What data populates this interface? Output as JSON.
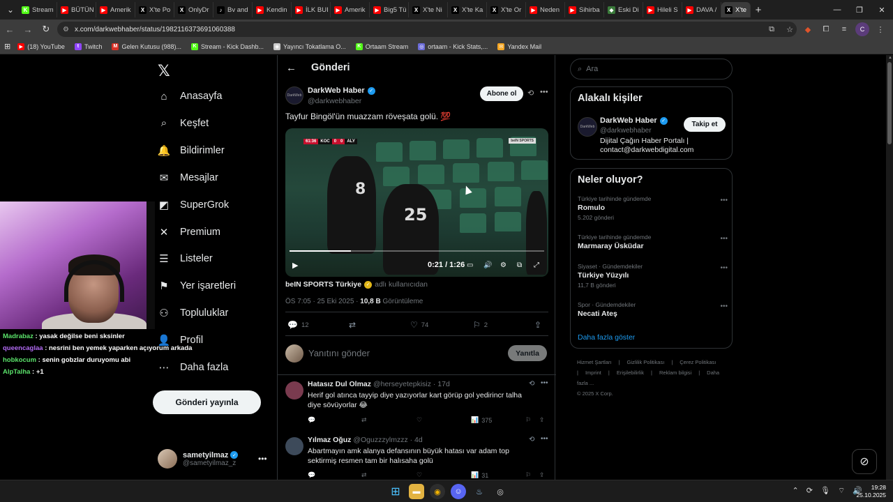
{
  "browser": {
    "tabs": [
      {
        "label": "Stream",
        "color": "#53fc18",
        "glyph": "K"
      },
      {
        "label": "BÜTÜN",
        "color": "#ff0000",
        "glyph": "▶"
      },
      {
        "label": "Amerik",
        "color": "#ff0000",
        "glyph": "▶"
      },
      {
        "label": "X'te Po",
        "color": "#000000",
        "glyph": "X"
      },
      {
        "label": "OnlyDr",
        "color": "#000000",
        "glyph": "X"
      },
      {
        "label": "Bv and",
        "color": "#000000",
        "glyph": "♪"
      },
      {
        "label": "Kendin",
        "color": "#ff0000",
        "glyph": "▶"
      },
      {
        "label": "İLK BUI",
        "color": "#ff0000",
        "glyph": "▶"
      },
      {
        "label": "Amerik",
        "color": "#ff0000",
        "glyph": "▶"
      },
      {
        "label": "Big5 Tü",
        "color": "#ff0000",
        "glyph": "▶"
      },
      {
        "label": "X'te Ni",
        "color": "#000000",
        "glyph": "X"
      },
      {
        "label": "X'te Ka",
        "color": "#000000",
        "glyph": "X"
      },
      {
        "label": "X'te Or",
        "color": "#000000",
        "glyph": "X"
      },
      {
        "label": "Neden",
        "color": "#ff0000",
        "glyph": "▶"
      },
      {
        "label": "Sihirba",
        "color": "#ff0000",
        "glyph": "▶"
      },
      {
        "label": "Eski Di",
        "color": "#3a7a3a",
        "glyph": "◆"
      },
      {
        "label": "Hileli S",
        "color": "#ff0000",
        "glyph": "▶"
      },
      {
        "label": "DAVA /",
        "color": "#ff0000",
        "glyph": "▶"
      }
    ],
    "active_tab": {
      "label": "X'te",
      "glyph": "X"
    },
    "url": "x.com/darkwebhaber/status/1982116373691060388",
    "bookmarks": [
      {
        "label": "(18) YouTube",
        "color": "#ff0000",
        "glyph": "▶"
      },
      {
        "label": "Twitch",
        "color": "#9146ff",
        "glyph": "t"
      },
      {
        "label": "Gelen Kutusu (988)...",
        "color": "#d93025",
        "glyph": "M"
      },
      {
        "label": "Stream - Kick Dashb...",
        "color": "#53fc18",
        "glyph": "K"
      },
      {
        "label": "Yayıncı Tokatlama O...",
        "color": "#cccccc",
        "glyph": "◉"
      },
      {
        "label": "Ortaam Stream",
        "color": "#53fc18",
        "glyph": "K"
      },
      {
        "label": "ortaam - Kick Stats,...",
        "color": "#6b6bd8",
        "glyph": "◎"
      },
      {
        "label": "Yandex Mail",
        "color": "#f5a623",
        "glyph": "✉"
      }
    ],
    "profile_initial": "C"
  },
  "nav": {
    "items": [
      {
        "label": "Anasayfa",
        "icon": "⌂"
      },
      {
        "label": "Keşfet",
        "icon": "⌕"
      },
      {
        "label": "Bildirimler",
        "icon": "🔔"
      },
      {
        "label": "Mesajlar",
        "icon": "✉"
      },
      {
        "label": "SuperGrok",
        "icon": "◩"
      },
      {
        "label": "Premium",
        "icon": "✕"
      },
      {
        "label": "Listeler",
        "icon": "☰"
      },
      {
        "label": "Yer işaretleri",
        "icon": "⚑"
      },
      {
        "label": "Topluluklar",
        "icon": "⚇"
      },
      {
        "label": "Profil",
        "icon": "👤"
      },
      {
        "label": "Daha fazla",
        "icon": "⋯"
      }
    ],
    "post_button": "Gönderi yayınla",
    "user": {
      "name": "sametyilmaz",
      "handle": "@sametyilmaz_z"
    }
  },
  "chat": [
    {
      "user": "Madrabaz",
      "msg": " : yasak değilse beni sksinler",
      "color": "#5be36b"
    },
    {
      "user": "queencaglaa",
      "msg": " : nesrini ben yemek yaparken açıyorum arkada",
      "color": "#b36bf5"
    },
    {
      "user": "hobkocum",
      "msg": " : senin gobzlar duruyomu abi",
      "color": "#5be36b"
    },
    {
      "user": "AlpTalha",
      "msg": " : +1",
      "color": "#5be36b"
    }
  ],
  "post": {
    "header_title": "Gönderi",
    "author": {
      "name": "DarkWeb Haber",
      "handle": "@darkwebhaber",
      "avatar_text": "DarkWeb"
    },
    "subscribe": "Abone ol",
    "text": "Tayfur Bingöl'ün muazzam röveşata golü. 💯",
    "video": {
      "time": "0:21 / 1:26",
      "progress": 0.24,
      "score_left": "KOC",
      "score_home": "0",
      "score_away": "0",
      "score_right": "ALY",
      "clock": "61:36",
      "broadcaster": "beIN SPORTS",
      "jersey_a": "8",
      "jersey_b": "25"
    },
    "source_name": "beIN SPORTS Türkiye",
    "source_rest": "adlı kullanıcıdan",
    "timestamp": "ÖS 7:05 · 25 Eki 2025 · ",
    "views": "10,8 B",
    "views_label": " Görüntüleme",
    "stats": {
      "replies": "12",
      "reposts": "",
      "likes": "74",
      "bookmarks": "2"
    },
    "reply_placeholder": "Yanıtını gönder",
    "reply_button": "Yanıtla"
  },
  "replies": [
    {
      "name": "Hatasız Dul Olmaz",
      "handle": "@herseyetepkisiz · 17d",
      "text": "Herif gol atınca tayyip diye yazıyorlar kart görüp gol yedirincr talha diye sövüyorlar 😂",
      "views": "375",
      "avatar_color": "#7a3b4f"
    },
    {
      "name": "Yılmaz Oğuz",
      "handle": "@Oguzzzylmzzz · 4d",
      "text": "Abartmayın amk alanya defansının büyük hatası var adam top sektirmiş resmen tam bir halısaha golü",
      "views": "31",
      "avatar_color": "#3d4a5a"
    }
  ],
  "sidebar": {
    "search_placeholder": "Ara",
    "related_title": "Alakalı kişiler",
    "related": {
      "name": "DarkWeb Haber",
      "handle": "@darkwebhaber",
      "bio": "Dijital Çağın Haber Portalı | contact@darkwebdigital.com",
      "follow": "Takip et",
      "avatar_text": "DarkWeb"
    },
    "trends_title": "Neler oluyor?",
    "trends": [
      {
        "context": "Türkiye tarihinde gündemde",
        "title": "Romulo",
        "count": "5.202 gönderi"
      },
      {
        "context": "Türkiye tarihinde gündemde",
        "title": "Marmaray Üsküdar",
        "count": ""
      },
      {
        "context": "Siyaset · Gündemdekiler",
        "title": "Türkiye Yüzyılı",
        "count": "11,7 B gönderi"
      },
      {
        "context": "Spor · Gündemdekiler",
        "title": "Necati Ateş",
        "count": ""
      }
    ],
    "show_more": "Daha fazla göster",
    "footer": [
      "Hizmet Şartları",
      "|",
      "Gizlilik Politikası",
      "|",
      "Çerez Politikası",
      "|",
      "Imprint",
      "|",
      "Erişilebilirlik",
      "|",
      "Reklam bilgisi",
      "|",
      "Daha fazla ...",
      "© 2025 X Corp."
    ]
  },
  "taskbar": {
    "time": "19:28",
    "date": "25.10.2025"
  }
}
